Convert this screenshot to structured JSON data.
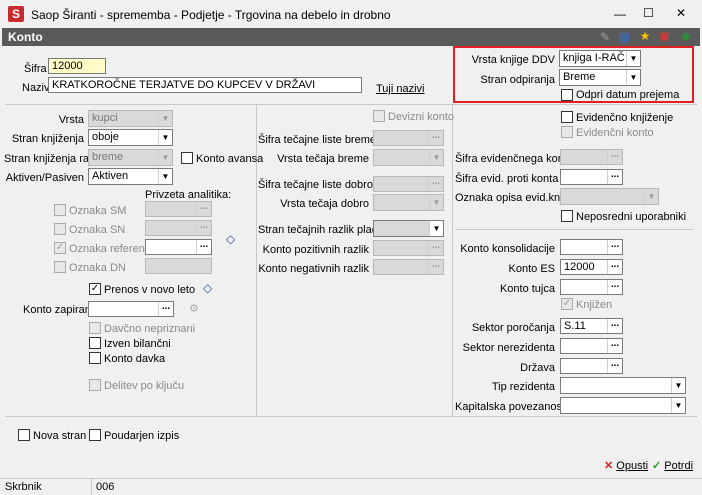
{
  "window": {
    "app_icon": "S",
    "title": "Saop Širanti - sprememba - Podjetje - Trgovina na debelo in drobno",
    "controls": [
      "—",
      "☐",
      "✕"
    ]
  },
  "header": {
    "title": "Konto"
  },
  "top": {
    "sifra_label": "Šifra",
    "sifra_value": "12000",
    "naziv_label": "Naziv",
    "naziv_value": "KRATKOROČNE TERJATVE DO KUPCEV V DRŽAVI",
    "tuji_nazivi": "Tuji nazivi",
    "vrsta_knjige_label": "Vrsta knjige DDV",
    "vrsta_knjige_value": "knjiga I-RAČ",
    "stran_odpiranja_label": "Stran odpiranja",
    "stran_odpiranja_value": "Breme",
    "odpri_datum_label": "Odpri datum prejema"
  },
  "left": {
    "vrsta_label": "Vrsta",
    "vrsta_value": "kupci",
    "stran_knjizenja_label": "Stran knjiženja",
    "stran_knjizenja_value": "oboje",
    "stran_knjizenja_rac_label": "Stran knjiženja rač.",
    "stran_knjizenja_rac_value": "breme",
    "konto_avansa_label": "Konto avansa",
    "aktiven_pasiven_label": "Aktiven/Pasiven",
    "aktiven_pasiven_value": "Aktiven",
    "privzeta_analitika": "Privzeta analitika:",
    "oznaka_sm": "Oznaka SM",
    "oznaka_sn": "Oznaka SN",
    "oznaka_referenta": "Oznaka referenta",
    "oznaka_dn": "Oznaka DN",
    "prenos_label": "Prenos v novo leto",
    "konto_zapiranja_label": "Konto zapiranja",
    "davcno_nepriznani": "Davčno nepriznani",
    "izven_bilancni": "Izven bilančni",
    "konto_davka": "Konto davka",
    "delitev_po_kljucu": "Delitev po ključu"
  },
  "middle": {
    "devizni_konto": "Devizni konto",
    "sifra_tecajne_breme": "Šifra tečajne liste breme",
    "vrsta_tecaja_breme": "Vrsta tečaja breme",
    "sifra_tecajne_dobro": "Šifra tečajne liste dobro",
    "vrsta_tecaja_dobro": "Vrsta tečaja dobro",
    "stran_tecajnih": "Stran tečajnih razlik plačila",
    "konto_pozitivnih": "Konto pozitivnih razlik",
    "konto_negativnih": "Konto negativnih razlik"
  },
  "right": {
    "evidencno_knjizenje": "Evidenčno knjiženje",
    "evidencni_konto": "Evidenčni konto",
    "sifra_evidencnega": "Šifra evidenčnega konta",
    "sifra_evid_proti": "Šifra evid. proti konta",
    "oznaka_opisa": "Oznaka opisa evid.knj.",
    "neposredni": "Neposredni uporabniki",
    "konto_konsolidacije": "Konto konsolidacije",
    "konto_es_label": "Konto ES",
    "konto_es_value": "12000",
    "konto_tujca": "Konto tujca",
    "knjizen": "Knjižen",
    "sektor_porocanja_label": "Sektor poročanja",
    "sektor_porocanja_value": "S.11",
    "sektor_nerezidenta": "Sektor nerezidenta",
    "drzava": "Država",
    "tip_rezidenta": "Tip rezidenta",
    "kapitalska": "Kapitalska povezanost"
  },
  "bottom": {
    "nova_stran": "Nova stran",
    "poudarjen_izpis": "Poudarjen izpis",
    "opusti": "Opusti",
    "potrdi": "Potrdi"
  },
  "status": {
    "left": "Skrbnik",
    "right": "006"
  },
  "colors": {
    "header_bg": "#5a5a5a",
    "highlight": "#e02020",
    "yellow_field": "#fffcc8"
  }
}
